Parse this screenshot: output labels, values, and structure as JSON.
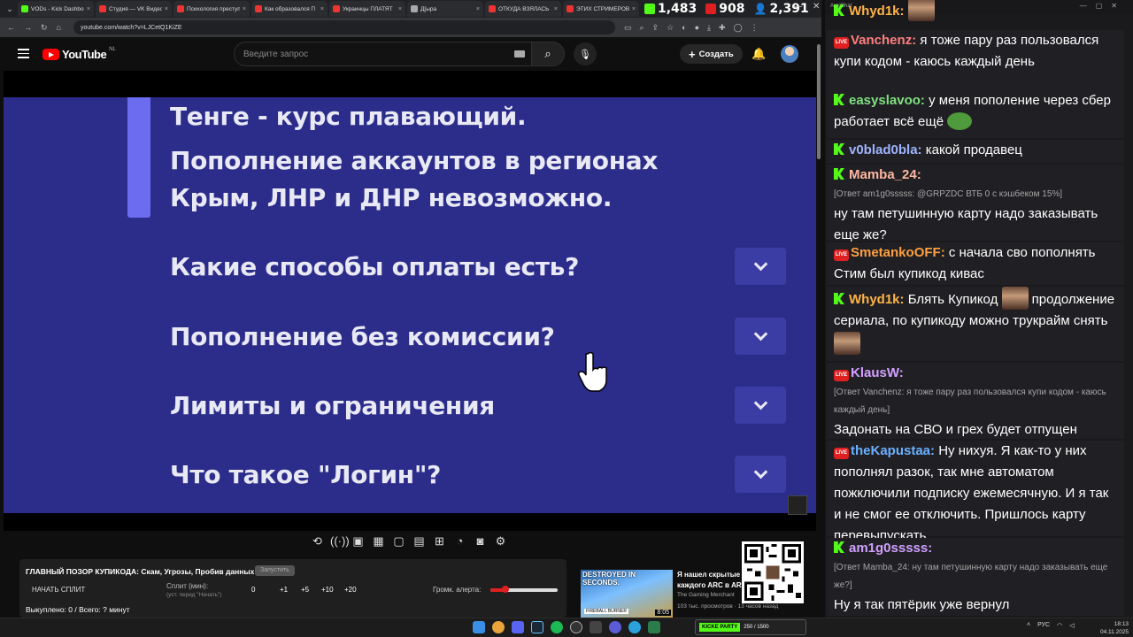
{
  "browser": {
    "tabs": [
      {
        "title": "VODs - Kick Dashbo",
        "color": "#53fc18"
      },
      {
        "title": "Студия — VK Видео",
        "color": "#e33"
      },
      {
        "title": "Психология преступ",
        "color": "#e33"
      },
      {
        "title": "Как образовался П",
        "color": "#e33"
      },
      {
        "title": "Украинцы ПЛАТЯТ",
        "color": "#e33"
      },
      {
        "title": "Д[ыра",
        "color": "#aaa"
      },
      {
        "title": "ОТКУДА ВЗЯЛАСЬ",
        "color": "#e33"
      },
      {
        "title": "ЭТИХ СТРИМЕРОВ",
        "color": "#e33"
      }
    ],
    "url": "youtube.com/watch?v=LJCetQ1KiZE"
  },
  "stream_stats": {
    "kick_viewers": "1,483",
    "vk_viewers": "908",
    "total_viewers": "2,391"
  },
  "youtube": {
    "logo_text": "YouTube",
    "region": "NL",
    "search_placeholder": "Введите запрос",
    "create_label": "Создать"
  },
  "video": {
    "line1": "Тенге - курс плавающий.",
    "line2": "Пополнение аккаунтов в регионах",
    "line3": "Крым, ЛНР и ДНР невозможно.",
    "faq": [
      "Какие способы оплаты есть?",
      "Пополнение без комиссии?",
      "Лимиты и ограничения",
      "Что такое \"Логин\"?"
    ]
  },
  "panel": {
    "title": "ГЛАВНЫЙ ПОЗОР КУПИКОДА: Скам, Угрозы, Пробив данных",
    "badge": "Запустить",
    "start_split": "НАЧАТЬ СПЛИТ",
    "split_label": "Сплит (мин):",
    "split_sub": "(уст. перед \"Начать\")",
    "values": [
      "0",
      "+1",
      "+5",
      "+10",
      "+20"
    ],
    "alert_label": "Громк. алерта:",
    "alert_volume": 0.22,
    "bought": "Выкуплено: 0 / Всего: ? минут"
  },
  "recommendation": {
    "thumb_text": "DESTROYED IN SECONDS.",
    "thumb_tag": "FIREBALL BURNER",
    "duration": "8:05",
    "title": "Я нашел скрытые каждого ARC в AR",
    "channel": "The Gaming Merchant",
    "meta": "103 тыс. просмотров · 13 часов назад"
  },
  "chat": {
    "window_title": "AxelChat",
    "messages": [
      {
        "platform": "vk",
        "nick": "Vanchenz",
        "color": "#ff7f7f",
        "text": "я тоже пару раз пользовался купи кодом - каюсь каждый день"
      },
      {
        "platform": "kick",
        "nick": "easyslavoo",
        "color": "#7fe07f",
        "text": "у меня пополение через сбер работает всё ещё"
      },
      {
        "platform": "kick",
        "nick": "v0blad0bla",
        "color": "#9fb4ff",
        "text": "какой продавец"
      },
      {
        "platform": "kick",
        "nick": "Mamba_24",
        "color": "#ffb6a0",
        "reply": "[Ответ am1g0sssss: @GRPZDC ВТБ 0 с кэшбеком 15%]",
        "text": "ну там петушинную карту надо заказывать еще же?"
      },
      {
        "platform": "vk",
        "nick": "SmetankoOFF",
        "color": "#ffa040",
        "text": "с начала сво пополнять Стим был купикод кивас"
      },
      {
        "platform": "kick",
        "nick": "Whyd1k",
        "color": "#ffb347",
        "text_a": "Блять Купикод",
        "text_b": "продолжение сериала, по купикоду можно трукрайм снять"
      },
      {
        "platform": "vk",
        "nick": "KlausW",
        "color": "#d4a0ff",
        "reply": "[Ответ Vanchenz: я тоже пару раз пользовался купи кодом - каюсь каждый день]",
        "text": "Задонать на СВО и грех будет отпущен"
      },
      {
        "platform": "vk",
        "nick": "theKapustaa",
        "color": "#6ab0ff",
        "text": "Ну нихуя. Я как-то у них пополнял разок, так мне автоматом пожключили подписку ежемесячную. И я так и не смог ее отключить. Пришлось карту перевыпускать"
      },
      {
        "platform": "kick",
        "nick": "am1g0sssss",
        "color": "#d0a0ff",
        "reply": "[Ответ Mamba_24: ну там петушинную карту надо заказывать еще же?]",
        "text": "Ну я так пятёрик уже вернул"
      }
    ]
  },
  "taskbar": {
    "kick_label": "KICKE PARTY",
    "kick_count": "250 / 1500",
    "lang": "РУС",
    "time": "18:13",
    "date": "04.11.2025"
  }
}
